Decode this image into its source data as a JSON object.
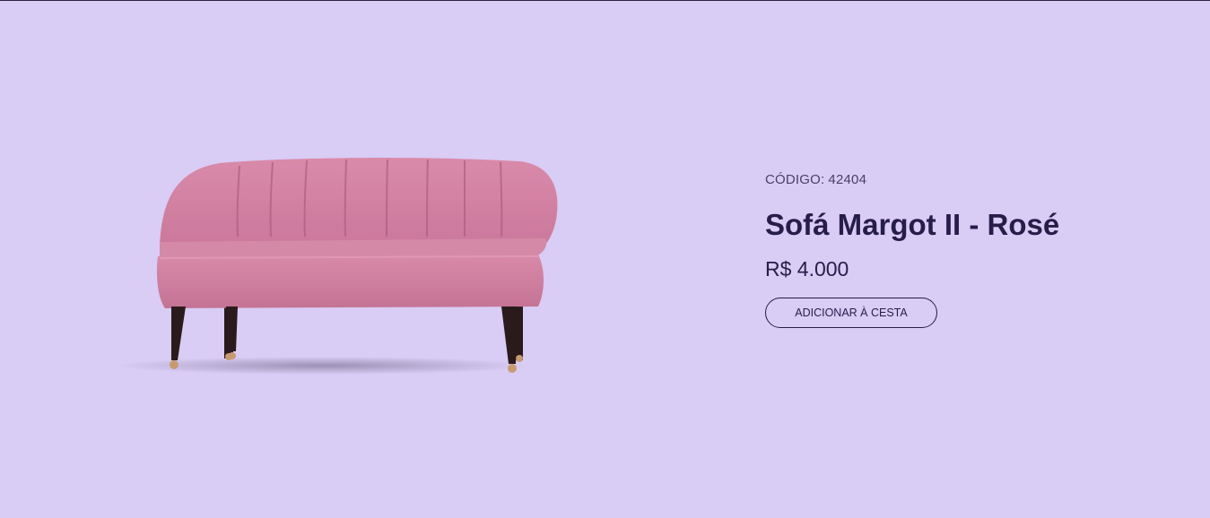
{
  "product": {
    "code_label": "CÓDIGO:",
    "code_value": "42404",
    "name": "Sofá Margot II - Rosé",
    "price": "R$ 4.000",
    "add_to_cart_label": "ADICIONAR À CESTA",
    "image_subject": "pink channel-tufted loveseat sofa with dark wooden legs",
    "colors": {
      "background": "#d9ccf5",
      "text_primary": "#271d4a",
      "text_secondary": "#4a4264",
      "sofa": "#d07f9f"
    }
  }
}
